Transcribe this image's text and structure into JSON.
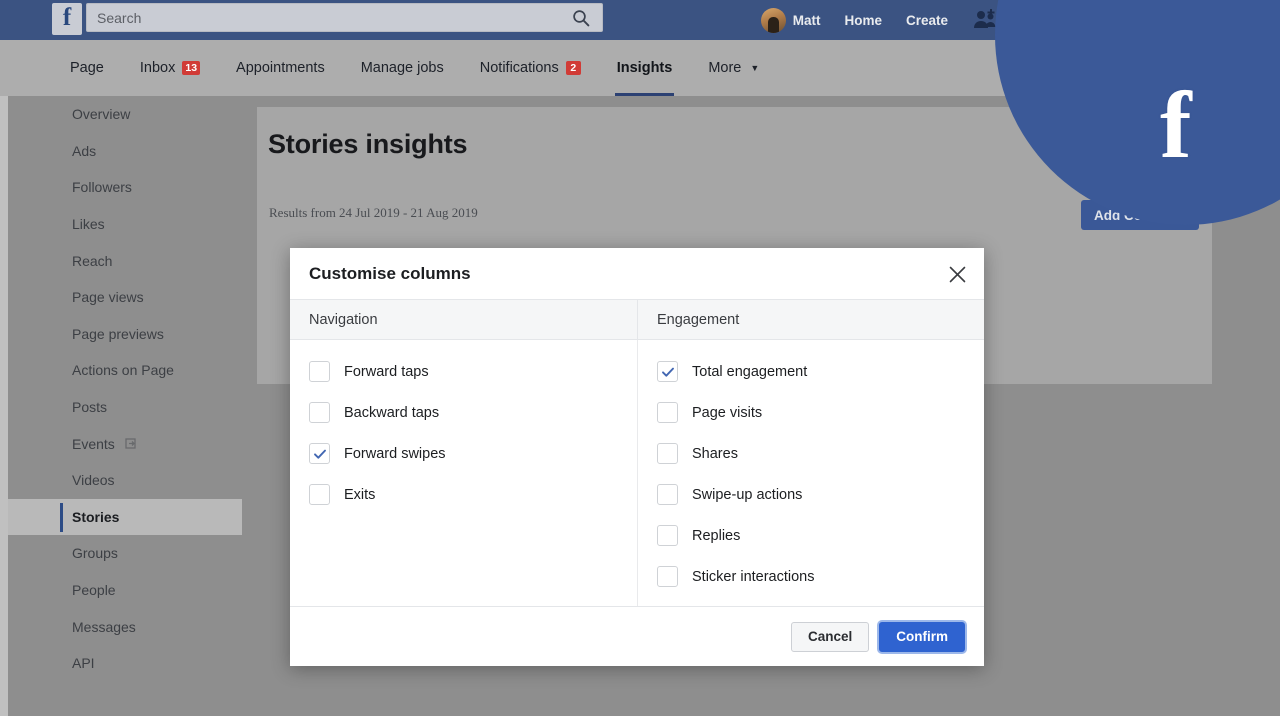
{
  "topbar": {
    "logo_letter": "f",
    "search": {
      "placeholder": "Search",
      "value": ""
    },
    "user_name": "Matt",
    "home_label": "Home",
    "create_label": "Create",
    "icons": {
      "friend_requests": "friend-requests-icon",
      "messenger": "messenger-icon",
      "search": "search-icon"
    }
  },
  "pagenav": {
    "items": [
      {
        "label": "Page",
        "badge": null,
        "active": false,
        "caret": false
      },
      {
        "label": "Inbox",
        "badge": "13",
        "active": false,
        "caret": false
      },
      {
        "label": "Appointments",
        "badge": null,
        "active": false,
        "caret": false
      },
      {
        "label": "Manage jobs",
        "badge": null,
        "active": false,
        "caret": false
      },
      {
        "label": "Notifications",
        "badge": "2",
        "active": false,
        "caret": false
      },
      {
        "label": "Insights",
        "badge": null,
        "active": true,
        "caret": false
      },
      {
        "label": "More",
        "badge": null,
        "active": false,
        "caret": true
      }
    ]
  },
  "sidebar": {
    "items": [
      {
        "label": "Overview",
        "active": false,
        "icon": null
      },
      {
        "label": "Ads",
        "active": false,
        "icon": null
      },
      {
        "label": "Followers",
        "active": false,
        "icon": null
      },
      {
        "label": "Likes",
        "active": false,
        "icon": null
      },
      {
        "label": "Reach",
        "active": false,
        "icon": null
      },
      {
        "label": "Page views",
        "active": false,
        "icon": null
      },
      {
        "label": "Page previews",
        "active": false,
        "icon": null
      },
      {
        "label": "Actions on Page",
        "active": false,
        "icon": null
      },
      {
        "label": "Posts",
        "active": false,
        "icon": null
      },
      {
        "label": "Events",
        "active": false,
        "icon": "external-link-icon"
      },
      {
        "label": "Videos",
        "active": false,
        "icon": null
      },
      {
        "label": "Stories",
        "active": true,
        "icon": null
      },
      {
        "label": "Groups",
        "active": false,
        "icon": null
      },
      {
        "label": "People",
        "active": false,
        "icon": null
      },
      {
        "label": "Messages",
        "active": false,
        "icon": null
      },
      {
        "label": "API",
        "active": false,
        "icon": null
      }
    ]
  },
  "content": {
    "page_title": "Stories insights",
    "results_line": "Results from 24 Jul 2019 - 21 Aug 2019",
    "add_columns_label": "Add Colu..."
  },
  "decor": {
    "logo_letter": "f",
    "circle_color": "#3b5998"
  },
  "modal": {
    "title": "Customise columns",
    "close_icon": "close-icon",
    "columns": [
      {
        "header": "Navigation",
        "options": [
          {
            "label": "Forward taps",
            "checked": false
          },
          {
            "label": "Backward taps",
            "checked": false
          },
          {
            "label": "Forward swipes",
            "checked": true
          },
          {
            "label": "Exits",
            "checked": false
          }
        ]
      },
      {
        "header": "Engagement",
        "options": [
          {
            "label": "Total engagement",
            "checked": true
          },
          {
            "label": "Page visits",
            "checked": false
          },
          {
            "label": "Shares",
            "checked": false
          },
          {
            "label": "Swipe-up actions",
            "checked": false
          },
          {
            "label": "Replies",
            "checked": false
          },
          {
            "label": "Sticker interactions",
            "checked": false
          }
        ]
      }
    ],
    "cancel_label": "Cancel",
    "confirm_label": "Confirm"
  },
  "colors": {
    "topbar_blue": "#3b5382",
    "accent_blue": "#2f63d0",
    "badge_red": "#d13b36",
    "check_blue": "#4267b2",
    "active_underline": "#2c4173"
  }
}
